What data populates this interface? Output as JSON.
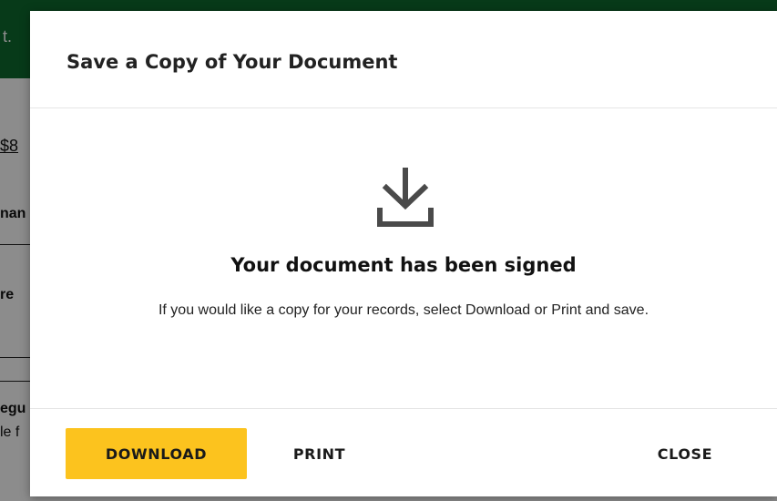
{
  "background": {
    "topbar_text": "t.",
    "amount": "$8",
    "fragments": [
      "nan",
      "re",
      "egu",
      "le f"
    ]
  },
  "dialog": {
    "title": "Save a Copy of Your Document",
    "icon": "download-icon",
    "heading": "Your document has been signed",
    "message": "If you would like a copy for your records, select Download or Print and save.",
    "buttons": {
      "download": "DOWNLOAD",
      "print": "PRINT",
      "close": "CLOSE"
    }
  },
  "colors": {
    "primary_button": "#fcc31e",
    "brand_green": "#0e6b2f"
  }
}
